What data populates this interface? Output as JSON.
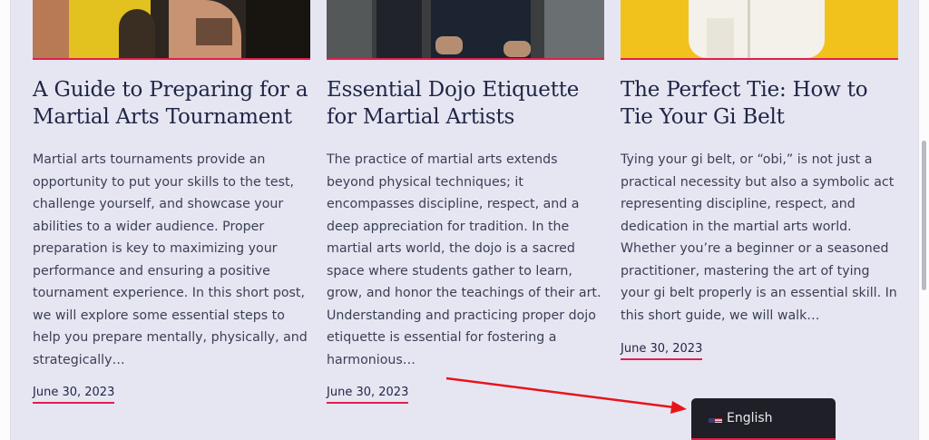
{
  "posts": [
    {
      "title": "A Guide to Preparing for a Martial Arts Tournament",
      "excerpt": "Martial arts tournaments provide an opportunity to put your skills to the test, challenge yourself, and showcase your abilities to a wider audience. Proper preparation is key to maximizing your performance and ensuring a positive tournament experience. In this short post, we will explore some essential steps to help you prepare mentally, physically, and strategically…",
      "date": "June 30, 2023"
    },
    {
      "title": "Essential Dojo Etiquette for Martial Artists",
      "excerpt": "The practice of martial arts extends beyond physical techniques; it encompasses discipline, respect, and a deep appreciation for tradition. In the martial arts world, the dojo is a sacred space where students gather to learn, grow, and honor the teachings of their art. Understanding and practicing proper dojo etiquette is essential for fostering a harmonious…",
      "date": "June 30, 2023"
    },
    {
      "title": "The Perfect Tie: How to Tie Your Gi Belt",
      "excerpt": "Tying your gi belt, or “obi,” is not just a practical necessity but also a symbolic act representing discipline, respect, and dedication in the martial arts world. Whether you’re a beginner or a seasoned practitioner, mastering the art of tying your gi belt properly is an essential skill. In this short guide, we will walk…",
      "date": "June 30, 2023"
    }
  ],
  "language_switcher": {
    "label": "English",
    "flag_icon": "us-flag-icon"
  },
  "colors": {
    "accent": "#e01f4c",
    "heading": "#1f2545",
    "background": "#e6e6f2",
    "annotation_arrow": "#e8141b"
  }
}
